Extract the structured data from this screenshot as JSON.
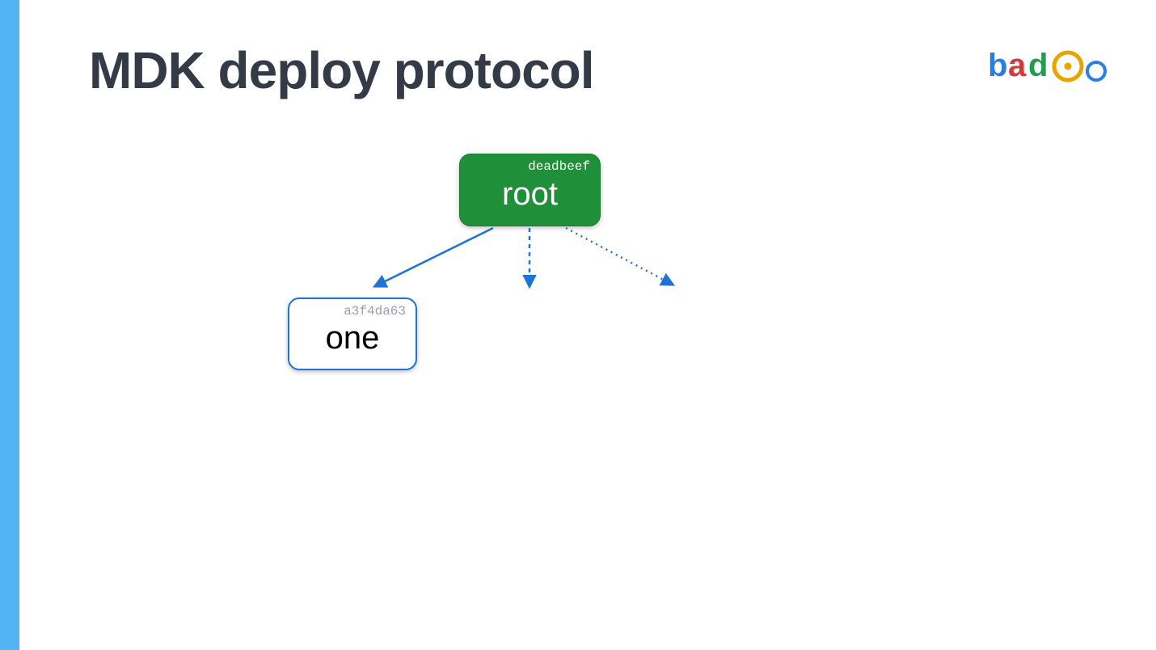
{
  "title": "MDK deploy protocol",
  "logo": {
    "name": "badoo"
  },
  "nodes": {
    "root": {
      "hash": "deadbeef",
      "label": "root"
    },
    "one": {
      "hash": "a3f4da63",
      "label": "one"
    }
  },
  "edges": [
    {
      "from": "root",
      "to": "one",
      "style": "solid"
    },
    {
      "from": "root",
      "to": "_placeholder_center",
      "style": "dashed"
    },
    {
      "from": "root",
      "to": "_placeholder_right",
      "style": "dotted"
    }
  ]
}
